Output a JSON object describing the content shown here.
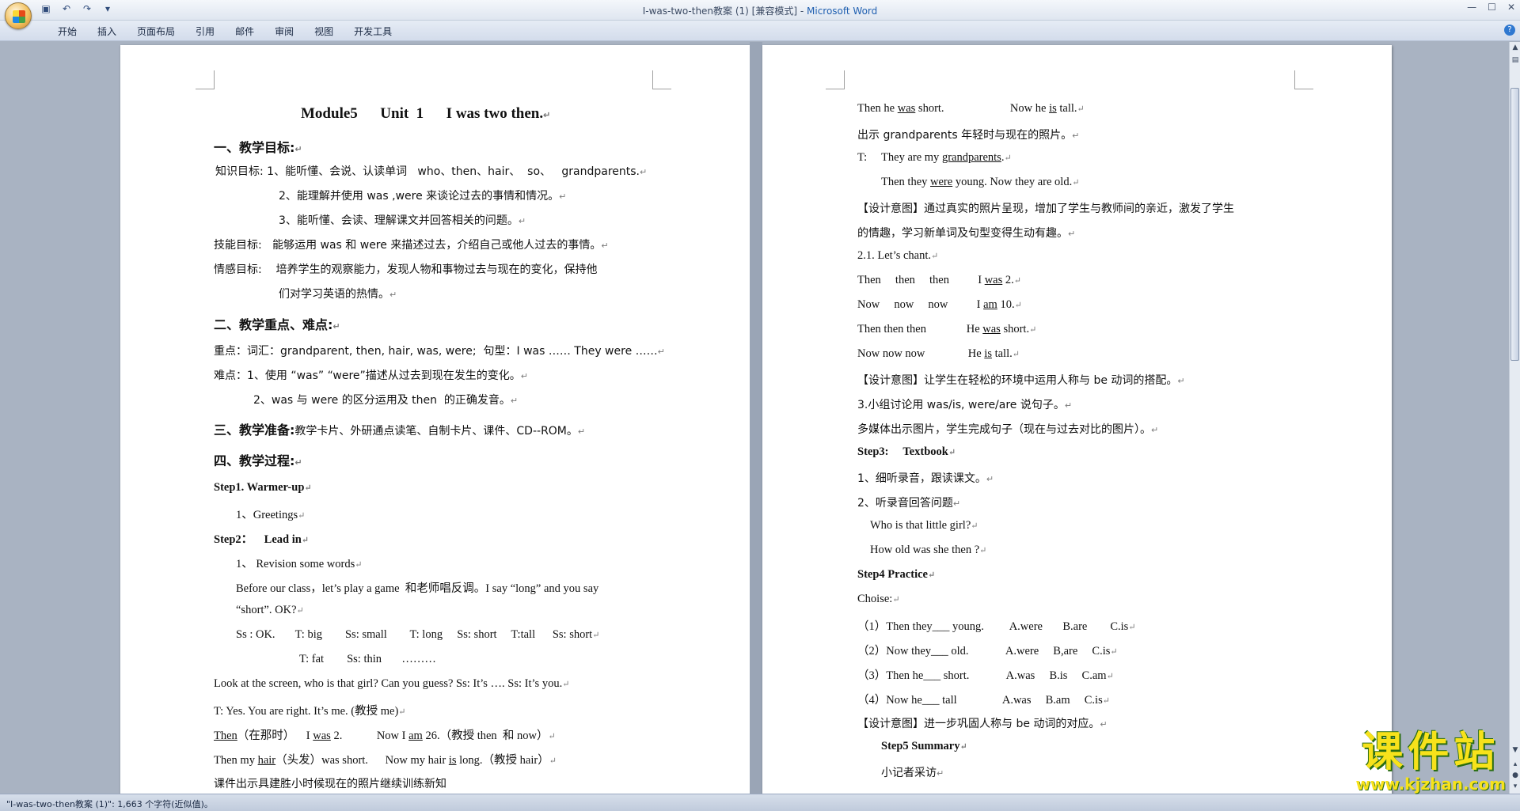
{
  "window": {
    "title": "I-was-two-then教案 (1) [兼容模式] - ",
    "app_name": "Microsoft Word",
    "qat": {
      "save": "▣",
      "undo": "↶",
      "redo": "↷",
      "customize": "▾"
    },
    "controls": {
      "minimize": "—",
      "maximize": "☐",
      "close": "✕"
    }
  },
  "ribbon": {
    "tabs": [
      "开始",
      "插入",
      "页面布局",
      "引用",
      "邮件",
      "审阅",
      "视图",
      "开发工具"
    ],
    "help": "?"
  },
  "left_page": {
    "title": "Module5      Unit  1      I was two then.",
    "lines": [
      "一、教学目标:",
      "知识目标: 1、能听懂、会说、认读单词   who、then、hair、  so、   grandparents.",
      "2、能理解并使用 was ,were 来谈论过去的事情和情况。",
      "3、能听懂、会读、理解课文并回答相关的问题。",
      "技能目标:   能够运用 was 和 were 来描述过去，介绍自己或他人过去的事情。",
      "情感目标:    培养学生的观察能力，发现人物和事物过去与现在的变化，保持他",
      "们对学习英语的热情。",
      "二、教学重点、难点:",
      "重点：词汇：grandparent, then, hair, was, were;  句型：I was …… They were ……",
      "难点：1、使用 “was” “were”描述从过去到现在发生的变化。",
      "2、was 与 were 的区分运用及 then  的正确发音。",
      "教学卡片、外研通点读笔、自制卡片、课件、CD--ROM。",
      "四、教学过程:",
      "Step1. Warmer-up",
      "1、Greetings",
      "Step2：    Lead in",
      "1、 Revision some words",
      "Before our class，let’s play a game  和老师唱反调。I say “long” and you say",
      "“short”. OK?",
      "Ss : OK.       T: big        Ss: small        T: long     Ss: short     T:tall      Ss: short",
      "T: fat        Ss: thin       ………",
      "Look at the screen, who is that girl? Can you guess? Ss: It’s …. Ss: It’s you.",
      "T: Yes. You are right. It’s me. (教授 me)",
      "（在那时）    I ",
      " 2.            Now I ",
      " 26.（教授 then  和 now）",
      "Then my ",
      "（头发）was short.      Now my hair ",
      " long.（教授 hair）",
      "课件出示具建胜小时候现在的照片继续训练新知"
    ],
    "heading3": "三、教学准备:",
    "u_then": "Then",
    "u_was": "was",
    "u_am": "am",
    "u_hair": "hair",
    "u_is": "is"
  },
  "right_page": {
    "lines": [
      "Then he ",
      " short.                       Now he ",
      " tall.",
      "出示 grandparents 年轻时与现在的照片。",
      "T:     They are my ",
      "Then they ",
      " young. Now they are old.",
      "【设计意图】通过真实的照片呈现，增加了学生与教师间的亲近，激发了学生",
      "的情趣，学习新单词及句型变得生动有趣。",
      "2.1. Let’s chant.",
      "Then     then     then          I ",
      " 2.",
      "Now     now     now          I ",
      " 10.",
      "Then then then              He ",
      " short.",
      "Now now now               He ",
      " tall.",
      "【设计意图】让学生在轻松的环境中运用人称与 be 动词的搭配。",
      "3.小组讨论用 was/is, were/are 说句子。",
      "多媒体出示图片，学生完成句子（现在与过去对比的图片）。",
      "Step3:     Textbook",
      "1、细听录音，跟读课文。",
      "2、听录音回答问题",
      "Who is that little girl?",
      "How old was she then ?",
      "Step4 Practice",
      "Choise:",
      "（1）Then they___ young.         A.were       B.are        C.is",
      "（2）Now they___ old.             A.were     B,are     C.is",
      "（3）Then he___ short.             A.was     B.is     C.am",
      "（4）Now he___ tall                A.was     B.am     C.is",
      "【设计意图】进一步巩固人称与 be 动词的对应。",
      "Step5 Summary",
      "小记者采访"
    ],
    "u_was": "was",
    "u_is": "is",
    "u_grandparents": "grandparents",
    "u_were": "were",
    "u_am": "am"
  },
  "paragraph_mark": "↵",
  "status": {
    "text": "\"I-was-two-then教案 (1)\": 1,663 个字符(近似值)。"
  },
  "watermark": {
    "cn": "课件站",
    "url": "www.kjzhan.com"
  }
}
